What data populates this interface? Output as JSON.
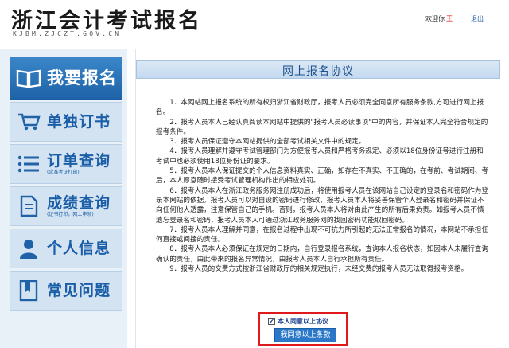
{
  "header": {
    "title": "浙江会计考试报名",
    "subtitle": "KJBM.ZJCZT.GOV.CN",
    "welcome": "欢迎你",
    "username": "王",
    "logout_label": "退出"
  },
  "sidebar": {
    "items": [
      {
        "label": "我要报名",
        "sub": "",
        "icon": "book-open-icon"
      },
      {
        "label": "单独订书",
        "sub": "",
        "icon": "cart-icon"
      },
      {
        "label": "订单查询",
        "sub": "(含准考证打印)",
        "icon": "list-icon"
      },
      {
        "label": "成绩查询",
        "sub": "(证书打印，网上申领)",
        "icon": "document-icon"
      },
      {
        "label": "个人信息",
        "sub": "",
        "icon": "person-icon"
      },
      {
        "label": "常见问题",
        "sub": "",
        "icon": "bookmark-icon"
      }
    ]
  },
  "main": {
    "title": "网上报名协议",
    "paragraphs": [
      "1．本网站网上报名系统的所有权归浙江省财政厅，报考人员必须完全同意所有服务条款,方可进行网上报名。",
      "2．报考人员本人已经认真阅读本网站中提供的\"报考人员必读事项\"中的内容，并保证本人完全符合规定的报考条件。",
      "3．报考人员保证遵守本网站提供的全部考试相关文件中的规定。",
      "4．报考人员理解并遵守考试管理部门为方便报考人员和严格考务规定、必须以18位身份证号进行注册和考试中也必须使用18位身份证的要求。",
      "5．报考人员本人保证提交的个人信息资料真实、正确，如存在不真实、不正确的，在考前、考试期间、考后，本人愿意随时接受考试管理机构作出的相应处罚。",
      "6．报考人员本人在浙江政务服务网注册成功后，将使用报考人员在该网站自己设定的登录名和密码作为登录本网站的依据。报考人员可以对自设的密码进行修改，报考人员本人将妥善保管个人登录名和密码并保证不向任何他人透露，注意保管自己的手机。否则，报考人员本人将对由此产生的所有后果负责。如报考人员不慎遗忘登录名和密码，报考人员本人可通过浙江政务服务网的找回密码功能取回密码。",
      "7．报考人员本人理解并同意，在报名过程中出现不可抗力所引起的无法正常报名的情况，本网站不承担任何直接或间接的责任。",
      "8．报考人员本人必须保证在规定的日期内，自行登录报名系统，查询本人报名状态，如因本人未履行查询确认的责任，由此带来的报名异常情况，由报考人员本人自行承担所有责任。",
      "9．报考人员的交费方式按浙江省财政厅的相关规定执行，未经交费的报考人员无法取得报考资格。"
    ],
    "agree_checkbox_label": "本人同意以上协议",
    "agree_checked": "✔",
    "submit_label": "我同意以上条款"
  },
  "colors": {
    "accent": "#1f62a8",
    "highlight_border": "#e0191c"
  }
}
